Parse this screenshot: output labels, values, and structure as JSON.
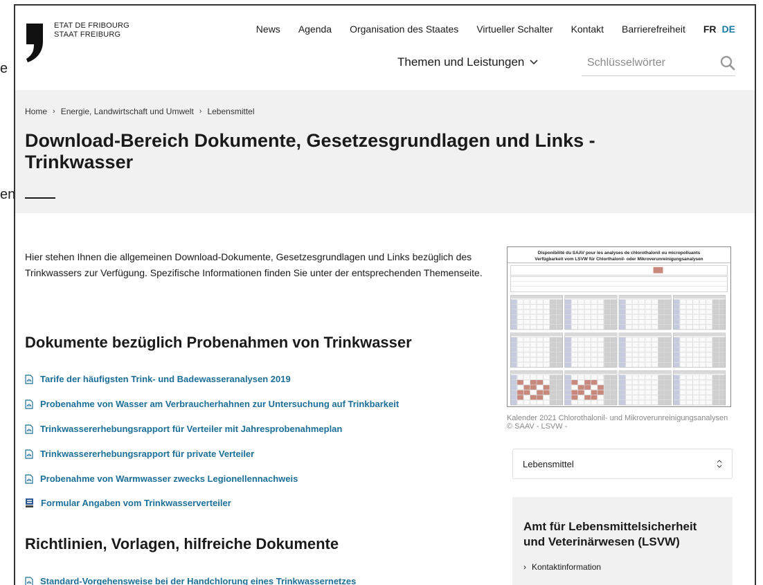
{
  "side": {
    "text1": "e",
    "text2": "en"
  },
  "header": {
    "logo_line1": "ETAT DE FRIBOURG",
    "logo_line2": "STAAT FREIBURG",
    "nav": [
      "News",
      "Agenda",
      "Organisation des Staates",
      "Virtueller Schalter",
      "Kontakt",
      "Barrierefreiheit"
    ],
    "lang_fr": "FR",
    "lang_de": "DE",
    "themen": "Themen und Leistungen",
    "search_placeholder": "Schlüsselwörter"
  },
  "breadcrumb": [
    "Home",
    "Energie, Landwirtschaft und Umwelt",
    "Lebensmittel"
  ],
  "title": "Download-Bereich Dokumente, Gesetzesgrundlagen und Links - Trinkwasser",
  "intro": "Hier stehen Ihnen die allgemeinen Download-Dokumente, Gesetzesgrundlagen und Links bezüglich des Trinkwassers zur Verfügung. Spezifische Informationen finden Sie unter der entsprechenden Themenseite.",
  "section1": {
    "heading": "Dokumente bezüglich Probenahmen von Trinkwasser",
    "links": [
      "Tarife der häufigsten Trink- und Badewasseranalysen 2019",
      "Probenahme von Wasser am Verbraucherhahnen zur Untersuchung auf Trinkbarkeit",
      "Trinkwassererhebungsrapport für Verteiler mit Jahresprobenahmeplan",
      "Trinkwassererhebungsrapport für private Verteiler",
      "Probenahme von Warmwasser zwecks Legionellennachweis",
      "Formular Angaben vom Trinkwasserverteiler"
    ]
  },
  "section2": {
    "heading": "Richtlinien, Vorlagen, hilfreiche Dokumente",
    "links": [
      "Standard-Vorgehensweise bei der Handchlorung eines Trinkwassernetzes"
    ]
  },
  "calendar": {
    "title_fr": "Disponibilité du SAAV pour les analyses de chlorothalonil ou micropolluants",
    "title_de": "Verfügbarkeit vom LSVW für Chlorthalonil- oder Mikroverunreinigungsanalysen"
  },
  "caption": "Kalender 2021 Chlorothalonil- und Mikroverunreinigungsanalysen © SAAV - LSVW -",
  "select_value": "Lebensmittel",
  "amt": {
    "title": "Amt für Lebensmittelsicherheit und Veterinärwesen (LSVW)",
    "link": "Kontaktinformation"
  },
  "colors": {
    "link": "#1b6f98",
    "accent": "#1b7aa5",
    "hero_bg": "#f1f1f1"
  }
}
